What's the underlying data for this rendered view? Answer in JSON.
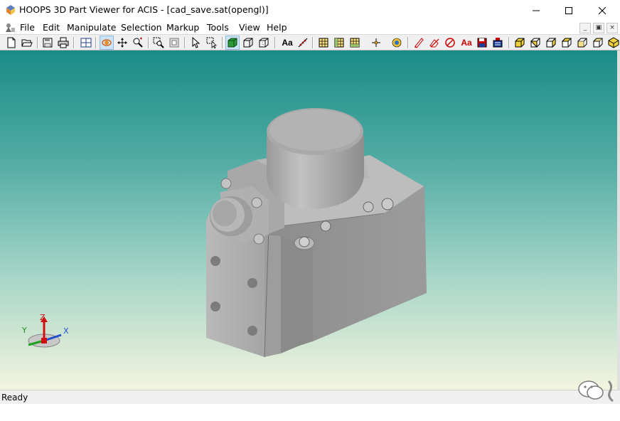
{
  "window": {
    "title": "HOOPS 3D Part Viewer for ACIS - [cad_save.sat(opengl)]",
    "app_icon": "hoops-logo-icon",
    "controls": [
      "minimize-icon",
      "maximize-icon",
      "close-icon"
    ]
  },
  "menubar": {
    "items": [
      {
        "label": "File"
      },
      {
        "label": "Edit"
      },
      {
        "label": "Manipulate"
      },
      {
        "label": "Selection"
      },
      {
        "label": "Markup"
      },
      {
        "label": "Tools"
      },
      {
        "label": "View"
      },
      {
        "label": "Help"
      }
    ],
    "mdi_buttons": [
      "mdi-minimize-icon",
      "mdi-restore-icon",
      "mdi-close-icon"
    ]
  },
  "toolbar": {
    "buttons": [
      {
        "icon": "new-file-icon"
      },
      {
        "icon": "open-folder-icon"
      },
      {
        "icon": "save-icon"
      },
      {
        "icon": "print-icon"
      },
      {
        "icon": "grid-view-icon"
      },
      {
        "icon": "orbit-icon",
        "pressed": true
      },
      {
        "icon": "pan-icon"
      },
      {
        "icon": "zoom-icon"
      },
      {
        "icon": "zoom-window-icon"
      },
      {
        "icon": "zoom-extents-icon"
      },
      {
        "icon": "select-arrow-icon"
      },
      {
        "icon": "select-window-icon"
      },
      {
        "icon": "shaded-mode-icon",
        "pressed": true
      },
      {
        "icon": "wireframe-mode-icon"
      },
      {
        "icon": "hidden-line-mode-icon"
      },
      {
        "label": "Aa",
        "icon": "text-annotation-icon"
      },
      {
        "icon": "measure-icon"
      },
      {
        "icon": "section-plane-x-icon"
      },
      {
        "icon": "section-plane-y-icon"
      },
      {
        "icon": "section-plane-z-icon"
      },
      {
        "icon": "point-snap-icon"
      },
      {
        "icon": "render-options-icon"
      },
      {
        "icon": "markup-pencil-icon"
      },
      {
        "icon": "markup-erase-icon"
      },
      {
        "icon": "markup-delete-icon"
      },
      {
        "label": "Aa",
        "icon": "markup-text-icon"
      },
      {
        "icon": "markup-save-icon"
      },
      {
        "icon": "markup-layers-icon"
      },
      {
        "icon": "view-iso-icon"
      },
      {
        "icon": "view-front-icon"
      },
      {
        "icon": "view-back-icon"
      },
      {
        "icon": "view-left-icon"
      },
      {
        "icon": "view-right-icon"
      },
      {
        "icon": "view-top-icon"
      },
      {
        "icon": "view-bottom-icon"
      }
    ]
  },
  "viewport": {
    "model": "servo-valve-body",
    "axis_triad": {
      "x_label": "X",
      "y_label": "Y",
      "z_label": "Z"
    },
    "colors": {
      "gradient_top": "#1a8c87",
      "gradient_bottom": "#f3f4de",
      "model": "#a9a9a9"
    }
  },
  "statusbar": {
    "text": "Ready"
  },
  "watermark": {
    "icon": "wechat-logo-icon"
  }
}
